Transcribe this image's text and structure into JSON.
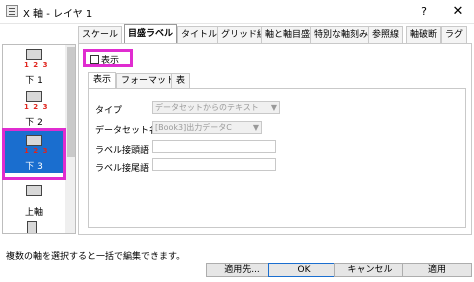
{
  "window": {
    "title": "X 軸 - レイヤ 1",
    "help_label": "?",
    "close_label": "✕"
  },
  "axis_list": [
    {
      "numbers": "1 2 3",
      "label": "下 1",
      "selected": false
    },
    {
      "numbers": "1 2 3",
      "label": "下 2",
      "selected": false
    },
    {
      "numbers": "1 2 3",
      "label": "下 3",
      "selected": true
    },
    {
      "numbers": "",
      "label": "上軸",
      "selected": false
    },
    {
      "numbers": "1 2 3",
      "label": "",
      "selected": false
    }
  ],
  "tabs": [
    "スケール",
    "目盛ラベル",
    "タイトル",
    "グリッド線",
    "軸と軸目盛",
    "特別な軸刻み",
    "参照線",
    "軸破断",
    "ラグ"
  ],
  "active_tab": "目盛ラベル",
  "show_checkbox": {
    "label": "表示",
    "checked": false
  },
  "subtabs": [
    "表示",
    "フォーマット",
    "表"
  ],
  "active_subtab": "表示",
  "form": {
    "type_label": "タイプ",
    "type_value": "データセットからのテキスト",
    "dataset_label": "データセット名",
    "dataset_value": "[Book3]出力データC",
    "prefix_label": "ラベル接頭語",
    "prefix_value": "",
    "suffix_label": "ラベル接尾語",
    "suffix_value": ""
  },
  "status": "複数の軸を選択すると一括で編集できます。",
  "buttons": {
    "apply_to": "適用先...",
    "ok": "OK",
    "cancel": "キャンセル",
    "apply": "適用"
  }
}
